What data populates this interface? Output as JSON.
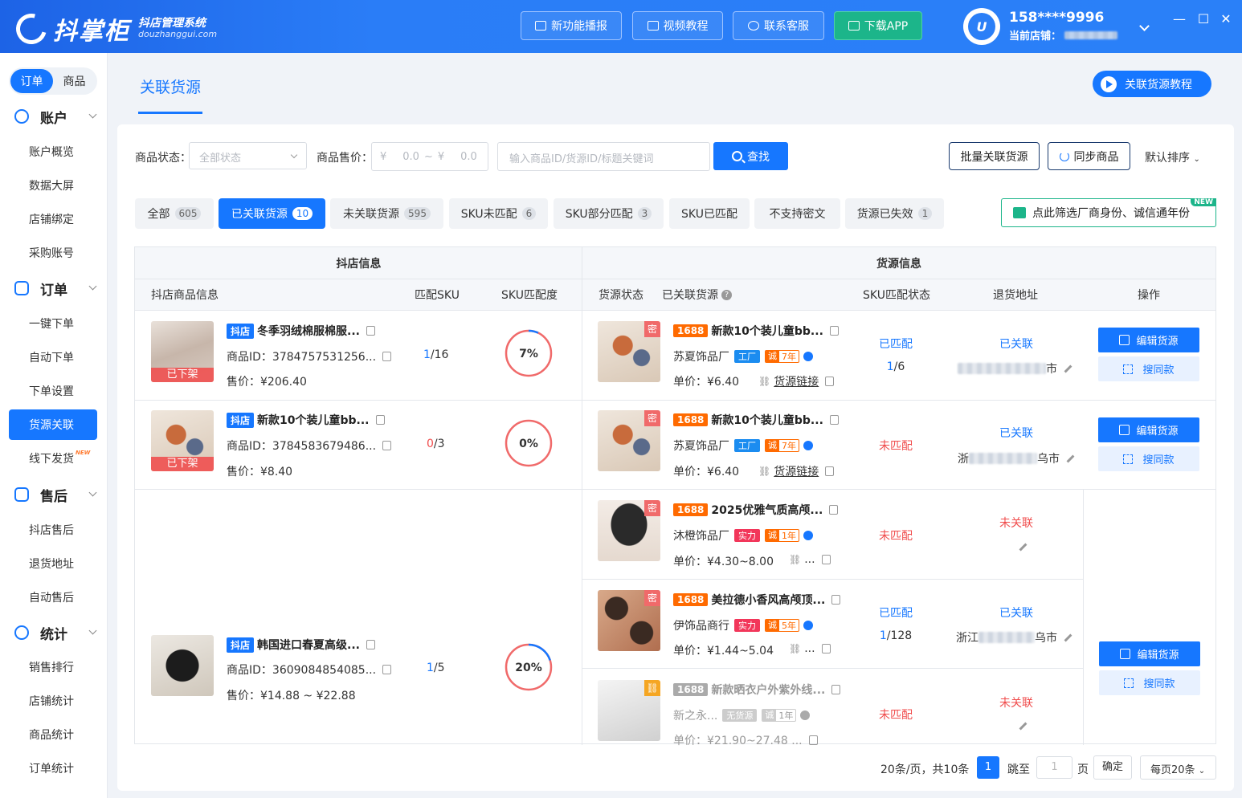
{
  "header": {
    "logo_name": "抖掌柜",
    "logo_tagline": "抖店管理系统",
    "logo_domain": "douzhanggui.com",
    "buttons": [
      {
        "label": "新功能播报"
      },
      {
        "label": "视频教程"
      },
      {
        "label": "联系客服"
      },
      {
        "label": "下载APP"
      }
    ],
    "avatar_text": "U",
    "user_phone": "158****9996",
    "current_shop_label": "当前店铺：",
    "window_controls": [
      "—",
      "☐",
      "✕"
    ]
  },
  "sidebar": {
    "segment": [
      "订单",
      "商品"
    ],
    "groups": [
      {
        "label": "账户",
        "items": [
          "账户概览",
          "数据大屏",
          "店铺绑定",
          "采购账号"
        ]
      },
      {
        "label": "订单",
        "items": [
          "一键下单",
          "自动下单",
          "下单设置",
          "货源关联",
          "线下发货"
        ]
      },
      {
        "label": "售后",
        "items": [
          "抖店售后",
          "退货地址",
          "自动售后"
        ]
      },
      {
        "label": "统计",
        "items": [
          "销售排行",
          "店铺统计",
          "商品统计",
          "订单统计"
        ]
      }
    ],
    "new_tag": "NEW"
  },
  "page": {
    "title": "关联货源",
    "tutorial_button": "关联货源教程"
  },
  "filters": {
    "status_label": "商品状态：",
    "status_placeholder": "全部状态",
    "price_label": "商品售价：",
    "price_currency": "¥",
    "price_min": "0.0",
    "price_sep": "~",
    "price_max": "0.0",
    "keyword_placeholder": "输入商品ID/货源ID/标题关键词",
    "search_button": "查找",
    "batch_button": "批量关联货源",
    "sync_button": "同步商品",
    "sort_label": "默认排序"
  },
  "tabs": [
    {
      "label": "全部",
      "count": "605"
    },
    {
      "label": "已关联货源",
      "count": "10"
    },
    {
      "label": "未关联货源",
      "count": "595"
    },
    {
      "label": "SKU未匹配",
      "count": "6"
    },
    {
      "label": "SKU部分匹配",
      "count": "3"
    },
    {
      "label": "SKU已匹配",
      "count": ""
    },
    {
      "label": "不支持密文",
      "count": ""
    },
    {
      "label": "货源已失效",
      "count": "1"
    }
  ],
  "filter_banner": {
    "text": "点此筛选厂商身份、诚信通年份",
    "badge": "NEW"
  },
  "table": {
    "group_headers": [
      "抖店信息",
      "货源信息"
    ],
    "columns": [
      "抖店商品信息",
      "匹配SKU",
      "SKU匹配度",
      "货源状态",
      "已关联货源",
      "SKU匹配状态",
      "退货地址",
      "操作"
    ],
    "help_icon": "?"
  },
  "rows": [
    {
      "shop": {
        "tag": "抖店",
        "title": "冬季羽绒棉服棉服...",
        "id": "商品ID：3784757531256...",
        "price": "售价：¥206.40",
        "off_shelf": "已下架"
      },
      "sku_matched": "1",
      "sku_total": "/16",
      "match_pct": "7%",
      "match_value": 7
    },
    {
      "shop": {
        "tag": "抖店",
        "title": "新款10个装儿童bb...",
        "id": "商品ID：3784583679486...",
        "price": "售价：¥8.40",
        "off_shelf": "已下架"
      },
      "sku_matched": "0",
      "sku_total": "/3",
      "match_pct": "0%",
      "match_value": 0
    },
    {
      "shop": {
        "tag": "抖店",
        "title": "韩国进口春夏高级...",
        "id": "商品ID：3609084854085...",
        "price": "售价：¥14.88 ~ ¥22.88",
        "off_shelf": ""
      },
      "sku_matched": "1",
      "sku_total": "/5",
      "match_pct": "20%",
      "match_value": 20
    }
  ],
  "sources": [
    {
      "secret": "密",
      "tag": "1688",
      "title": "新款10个装儿童bb...",
      "factory": "苏夏饰品厂",
      "badge": "工厂",
      "cheng": "诚",
      "years": "7年",
      "price": "单价：¥6.40",
      "link": "货源链接",
      "sku_status": "已匹配",
      "sku_count": "1",
      "sku_total": "/6",
      "link_status": "已关联",
      "addr_prefix": "",
      "addr_suffix": "市"
    },
    {
      "secret": "密",
      "tag": "1688",
      "title": "新款10个装儿童bb...",
      "factory": "苏夏饰品厂",
      "badge": "工厂",
      "cheng": "诚",
      "years": "7年",
      "price": "单价：¥6.40",
      "link": "货源链接",
      "sku_status": "未匹配",
      "sku_count": "",
      "sku_total": "",
      "link_status": "已关联",
      "addr_prefix": "浙",
      "addr_suffix": "乌市"
    },
    {
      "secret": "密",
      "tag": "1688",
      "title": "2025优雅气质高颅...",
      "factory": "沐橙饰品厂",
      "badge": "实力",
      "cheng": "诚",
      "years": "1年",
      "price": "单价：¥4.30~8.00",
      "link": "...",
      "sku_status": "未匹配",
      "sku_count": "",
      "sku_total": "",
      "link_status": "未关联",
      "addr_prefix": "",
      "addr_suffix": ""
    },
    {
      "secret": "密",
      "tag": "1688",
      "title": "美拉德小香风高颅顶...",
      "factory": "伊饰品商行",
      "badge": "实力",
      "cheng": "诚",
      "years": "5年",
      "price": "单价：¥1.44~5.04",
      "link": "...",
      "sku_status": "已匹配",
      "sku_count": "1",
      "sku_total": "/128",
      "link_status": "已关联",
      "addr_prefix": "浙江",
      "addr_suffix": "乌市"
    },
    {
      "secret": "",
      "tag": "1688",
      "title": "新款晒衣户外紫外线...",
      "factory": "新之永...",
      "badge": "无货源",
      "cheng": "诚",
      "years": "1年",
      "price": "单价：¥21.90~27.48 ...",
      "link": "",
      "sku_status": "未匹配",
      "sku_count": "",
      "sku_total": "",
      "link_status": "未关联",
      "addr_prefix": "",
      "addr_suffix": ""
    }
  ],
  "actions": {
    "edit": "编辑货源",
    "same": "搜同款"
  },
  "pagination": {
    "summary": "20条/页，共10条",
    "current": "1",
    "jump_label": "跳至",
    "jump_value": "1",
    "page_unit": "页",
    "confirm": "确定",
    "page_size": "每页20条"
  }
}
